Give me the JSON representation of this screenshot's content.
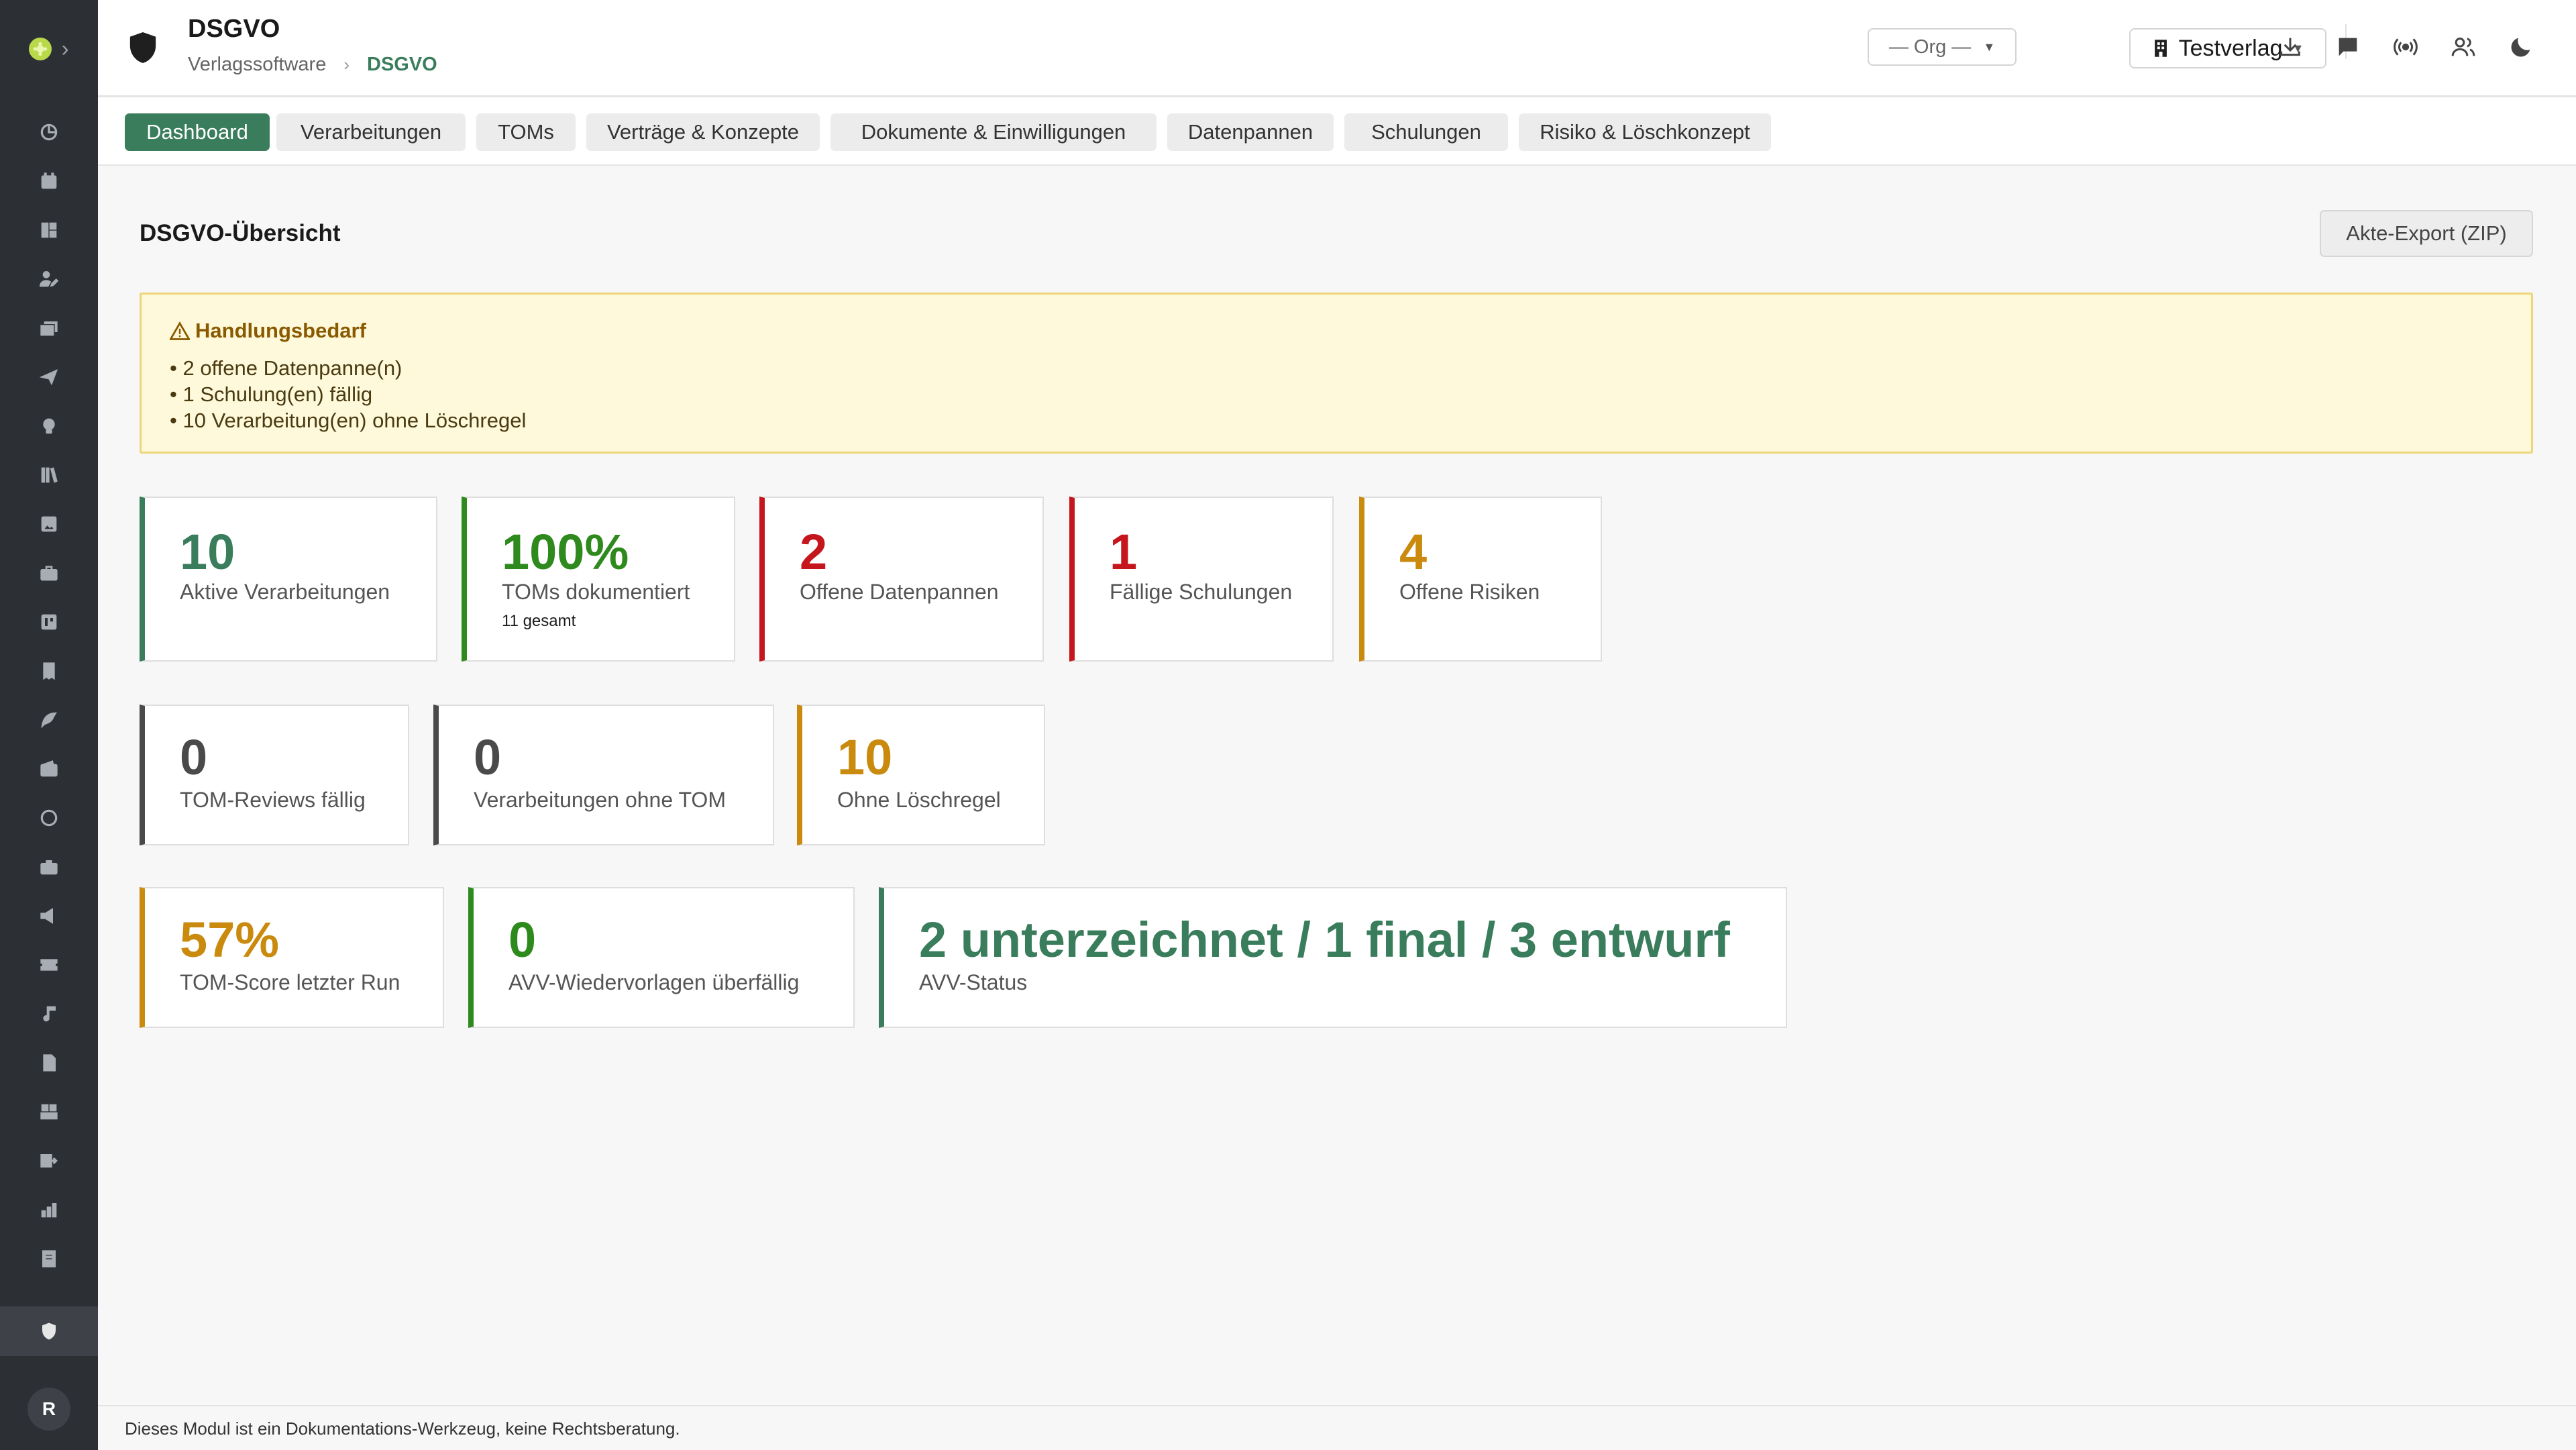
{
  "colors": {
    "accent": "#3a7d5c",
    "green": "#2f8a1e",
    "red": "#c4161c",
    "amber": "#c98a0e",
    "gray": "#4a4a4a"
  },
  "header": {
    "title": "DSGVO",
    "breadcrumb_parent": "Verlagssoftware",
    "breadcrumb_current": "DSGVO",
    "org_select": "— Org —",
    "publisher_select": "Testverlag",
    "icons": [
      "download-icon",
      "chat-icon",
      "broadcast-icon",
      "users-icon",
      "moon-icon"
    ]
  },
  "sidebar": {
    "icons": [
      "dashboard-icon",
      "calendar-icon",
      "widgets-icon",
      "user-edit-icon",
      "mail-stack-icon",
      "send-icon",
      "lightbulb-icon",
      "library-icon",
      "image-icon",
      "briefcase-icon",
      "board-icon",
      "receipt-icon",
      "feather-icon",
      "wallet-icon",
      "sync-icon",
      "case-icon",
      "megaphone-icon",
      "ticket-icon",
      "music-icon",
      "document-icon",
      "stamp-icon",
      "forward-icon",
      "bar-chart-icon",
      "page-icon"
    ],
    "active_icon": "shield-icon",
    "avatar_initial": "R"
  },
  "tabs": [
    {
      "label": "Dashboard",
      "active": true
    },
    {
      "label": "Verarbeitungen",
      "active": false
    },
    {
      "label": "TOMs",
      "active": false
    },
    {
      "label": "Verträge & Konzepte",
      "active": false
    },
    {
      "label": "Dokumente & Einwilligungen",
      "active": false
    },
    {
      "label": "Datenpannen",
      "active": false
    },
    {
      "label": "Schulungen",
      "active": false
    },
    {
      "label": "Risiko & Löschkonzept",
      "active": false
    }
  ],
  "main": {
    "title": "DSGVO-Übersicht",
    "export_button": "Akte-Export (ZIP)",
    "alert": {
      "title": "Handlungsbedarf",
      "items": [
        "2 offene Datenpanne(n)",
        "1 Schulung(en) fällig",
        "10 Verarbeitung(en) ohne Löschregel"
      ]
    },
    "cards_row1": [
      {
        "value": "10",
        "label": "Aktive Verarbeitungen",
        "color": "#3a7d5c"
      },
      {
        "value": "100%",
        "label": "TOMs dokumentiert",
        "sub": "11 gesamt",
        "color": "#2f8a1e"
      },
      {
        "value": "2",
        "label": "Offene Datenpannen",
        "color": "#c4161c"
      },
      {
        "value": "1",
        "label": "Fällige Schulungen",
        "color": "#c4161c"
      },
      {
        "value": "4",
        "label": "Offene Risiken",
        "color": "#c98a0e"
      }
    ],
    "cards_row2": [
      {
        "value": "0",
        "label": "TOM-Reviews fällig",
        "color": "#4a4a4a"
      },
      {
        "value": "0",
        "label": "Verarbeitungen ohne TOM",
        "color": "#4a4a4a"
      },
      {
        "value": "10",
        "label": "Ohne Löschregel",
        "color": "#c98a0e"
      }
    ],
    "cards_row3": [
      {
        "value": "57%",
        "label": "TOM-Score letzter Run",
        "color": "#c98a0e"
      },
      {
        "value": "0",
        "label": "AVV-Wiedervorlagen überfällig",
        "color": "#2f8a1e"
      },
      {
        "value": "2 unterzeichnet / 1 final / 3 entwurf",
        "label": "AVV-Status",
        "color": "#3a7d5c"
      }
    ]
  },
  "footer": {
    "text": "Dieses Modul ist ein Dokumentations-Werkzeug, keine Rechtsberatung."
  }
}
